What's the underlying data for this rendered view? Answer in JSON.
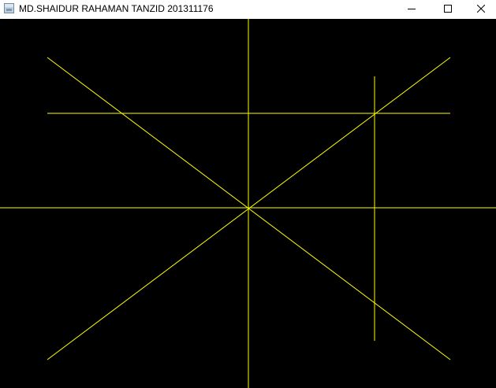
{
  "window": {
    "title": "MD.SHAIDUR RAHAMAN TANZID 201311176",
    "controls": {
      "minimize_icon": "minimize-icon",
      "maximize_icon": "maximize-icon",
      "close_icon": "close-icon"
    }
  },
  "canvas": {
    "background": "#000000",
    "line_color": "#ffff00"
  }
}
